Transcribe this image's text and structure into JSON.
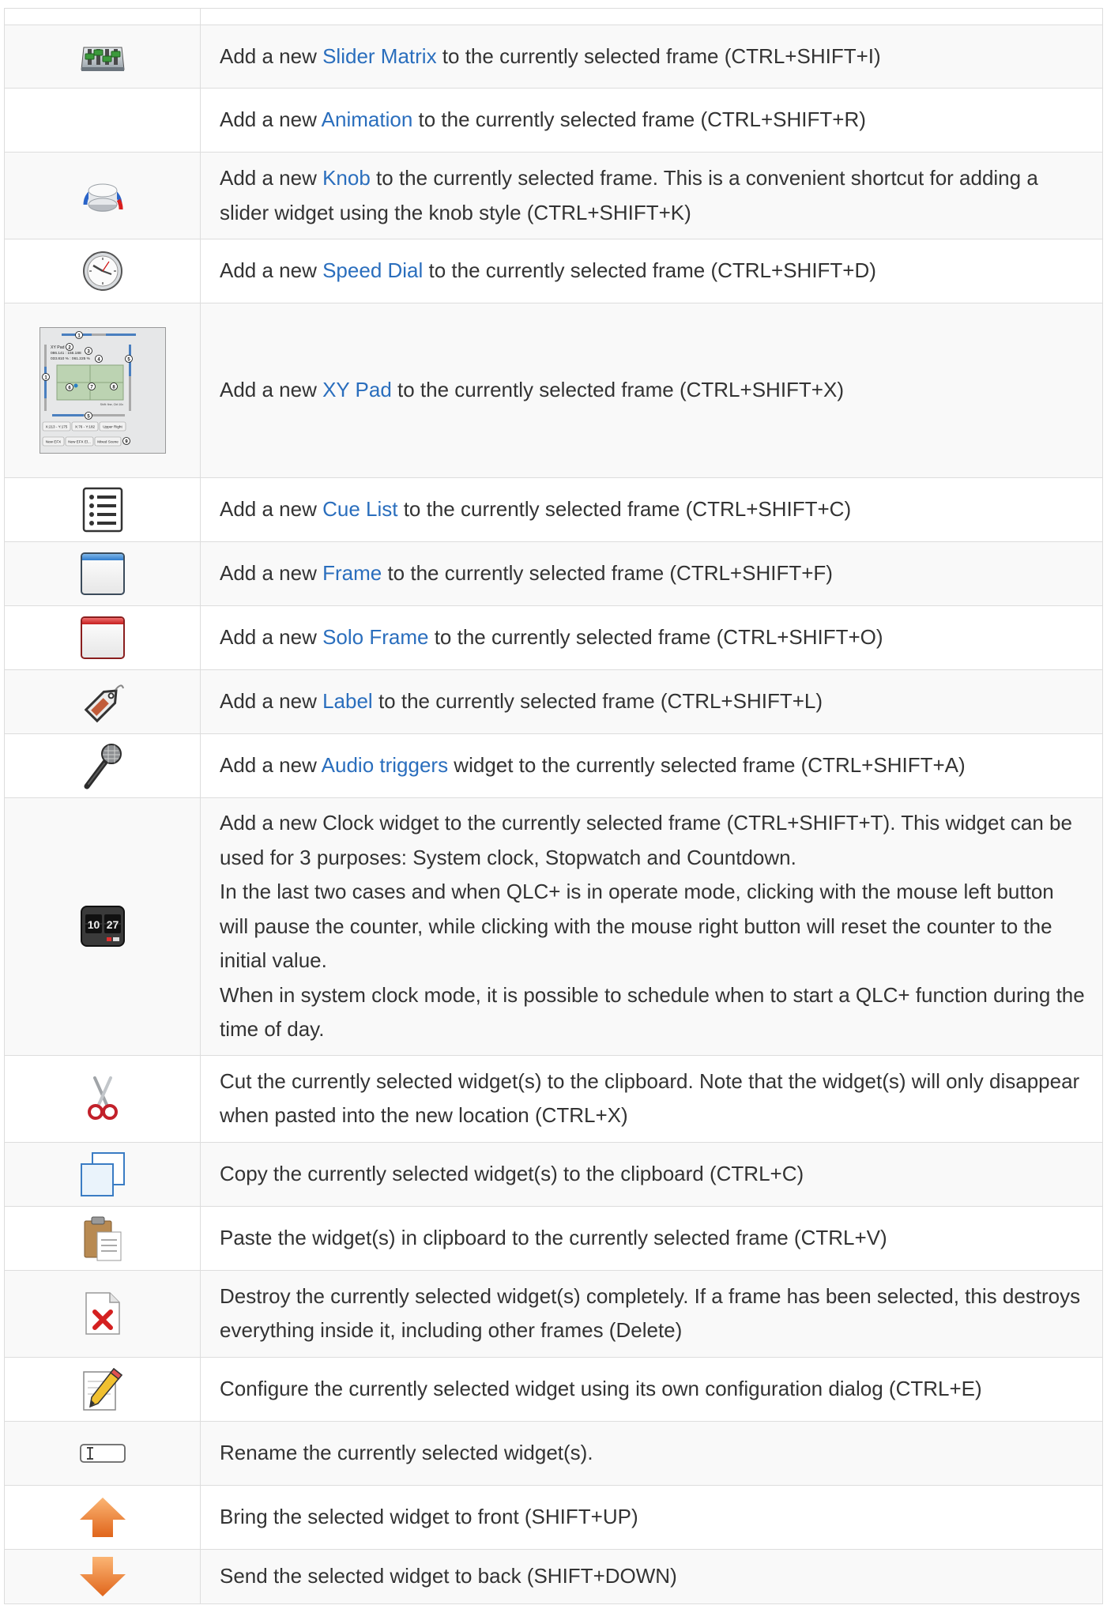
{
  "rows": [
    {
      "icon": "slider-matrix-icon",
      "shade": true,
      "segments": [
        {
          "text": "Add a new "
        },
        {
          "text": "Slider Matrix",
          "link": true
        },
        {
          "text": " to the currently selected frame (CTRL+SHIFT+I)"
        }
      ]
    },
    {
      "icon": "animation-icon",
      "shade": false,
      "segments": [
        {
          "text": "Add a new "
        },
        {
          "text": "Animation",
          "link": true
        },
        {
          "text": " to the currently selected frame (CTRL+SHIFT+R)"
        }
      ]
    },
    {
      "icon": "knob-icon",
      "shade": true,
      "segments": [
        {
          "text": "Add a new "
        },
        {
          "text": "Knob",
          "link": true
        },
        {
          "text": " to the currently selected frame. This is a convenient shortcut for adding a slider widget using the knob style (CTRL+SHIFT+K)"
        }
      ]
    },
    {
      "icon": "speed-dial-icon",
      "shade": false,
      "segments": [
        {
          "text": "Add a new "
        },
        {
          "text": "Speed Dial",
          "link": true
        },
        {
          "text": " to the currently selected frame (CTRL+SHIFT+D)"
        }
      ]
    },
    {
      "icon": "xy-pad-icon",
      "shade": true,
      "segments": [
        {
          "text": "Add a new "
        },
        {
          "text": "XY Pad",
          "link": true
        },
        {
          "text": " to the currently selected frame (CTRL+SHIFT+X)"
        }
      ]
    },
    {
      "icon": "cue-list-icon",
      "shade": false,
      "segments": [
        {
          "text": "Add a new "
        },
        {
          "text": "Cue List",
          "link": true
        },
        {
          "text": " to the currently selected frame (CTRL+SHIFT+C)"
        }
      ]
    },
    {
      "icon": "frame-icon",
      "shade": true,
      "segments": [
        {
          "text": "Add a new "
        },
        {
          "text": "Frame",
          "link": true
        },
        {
          "text": " to the currently selected frame (CTRL+SHIFT+F)"
        }
      ]
    },
    {
      "icon": "solo-frame-icon",
      "shade": false,
      "segments": [
        {
          "text": "Add a new "
        },
        {
          "text": "Solo Frame",
          "link": true
        },
        {
          "text": " to the currently selected frame (CTRL+SHIFT+O)"
        }
      ]
    },
    {
      "icon": "label-icon",
      "shade": true,
      "segments": [
        {
          "text": "Add a new "
        },
        {
          "text": "Label",
          "link": true
        },
        {
          "text": " to the currently selected frame (CTRL+SHIFT+L)"
        }
      ]
    },
    {
      "icon": "audio-triggers-icon",
      "shade": false,
      "segments": [
        {
          "text": "Add a new "
        },
        {
          "text": "Audio triggers",
          "link": true
        },
        {
          "text": " widget to the currently selected frame (CTRL+SHIFT+A)"
        }
      ]
    },
    {
      "icon": "clock-icon",
      "shade": true,
      "lines": [
        "Add a new Clock widget to the currently selected frame (CTRL+SHIFT+T). This widget can be used for 3 purposes: System clock, Stopwatch and Countdown.",
        "In the last two cases and when QLC+ is in operate mode, clicking with the mouse left button will pause the counter, while clicking with the mouse right button will reset the counter to the initial value.",
        "When in system clock mode, it is possible to schedule when to start a QLC+ function during the time of day."
      ]
    },
    {
      "icon": "cut-icon",
      "shade": false,
      "segments": [
        {
          "text": "Cut the currently selected widget(s) to the clipboard. Note that the widget(s) will only disappear when pasted into the new location (CTRL+X)"
        }
      ]
    },
    {
      "icon": "copy-icon",
      "shade": true,
      "segments": [
        {
          "text": "Copy the currently selected widget(s) to the clipboard (CTRL+C)"
        }
      ]
    },
    {
      "icon": "paste-icon",
      "shade": false,
      "segments": [
        {
          "text": "Paste the widget(s) in clipboard to the currently selected frame (CTRL+V)"
        }
      ]
    },
    {
      "icon": "delete-icon",
      "shade": true,
      "segments": [
        {
          "text": "Destroy the currently selected widget(s) completely. If a frame has been selected, this destroys everything inside it, including other frames (Delete)"
        }
      ]
    },
    {
      "icon": "configure-icon",
      "shade": false,
      "segments": [
        {
          "text": "Configure the currently selected widget using its own configuration dialog (CTRL+E)"
        }
      ]
    },
    {
      "icon": "rename-icon",
      "shade": true,
      "segments": [
        {
          "text": "Rename the currently selected widget(s)."
        }
      ]
    },
    {
      "icon": "bring-to-front-icon",
      "shade": false,
      "segments": [
        {
          "text": "Bring the selected widget to front (SHIFT+UP)"
        }
      ]
    },
    {
      "icon": "send-to-back-icon",
      "shade": true,
      "segments": [
        {
          "text": "Send the selected widget to back (SHIFT+DOWN)"
        }
      ]
    }
  ],
  "xy_pad_icon": {
    "title": "XY Pad",
    "readout_1": "086.141 : 156.188",
    "readout_2": "033.810 % : 061.225 %",
    "hint": "Shift: fine, Ctrl:10x",
    "preset_buttons": [
      "X:213 - Y:175",
      "X:76 - Y:182",
      "Upper Right"
    ],
    "scene_buttons": [
      "New EFX",
      "New EFX El...",
      "Mixed Scene"
    ],
    "callouts": [
      "1",
      "2",
      "3",
      "4",
      "5",
      "6",
      "7",
      "8",
      "9"
    ]
  },
  "clock_icon": {
    "digits_left": "10",
    "digits_right": "27"
  },
  "colors": {
    "link": "#2a6ebd",
    "text": "#333333",
    "border": "#dddddd",
    "stripe": "#f9f9f9"
  }
}
